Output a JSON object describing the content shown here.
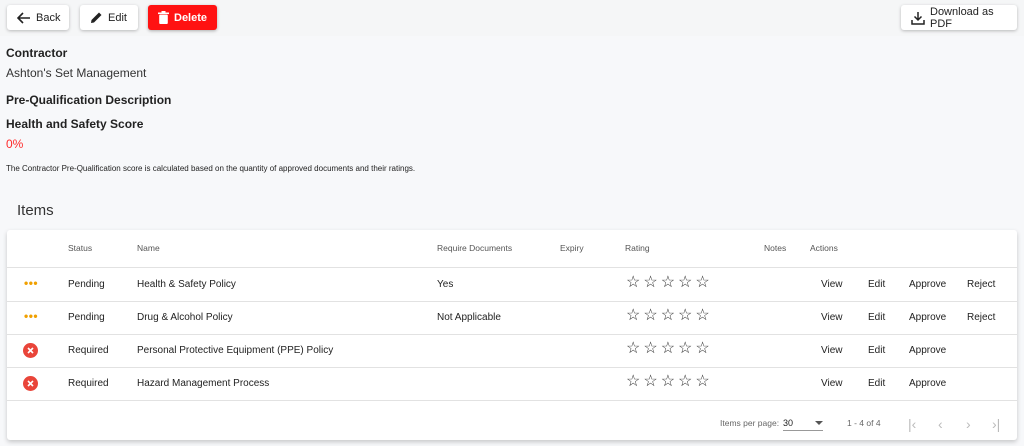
{
  "toolbar": {
    "back_label": "Back",
    "edit_label": "Edit",
    "delete_label": "Delete",
    "download_label": "Download as PDF",
    "delete_color": "#ff1212"
  },
  "details": {
    "contractor_label": "Contractor",
    "contractor_value": "Ashton's Set Management",
    "prequal_label": "Pre-Qualification Description",
    "hs_label": "Health and Safety Score",
    "hs_value": "0%",
    "score_color": "#ff2a2a",
    "note": "The Contractor Pre-Qualification score is calculated based on the quantity of approved documents and their ratings."
  },
  "items": {
    "title": "Items",
    "columns": [
      "Status",
      "Name",
      "Require Documents",
      "Expiry",
      "Rating",
      "Notes",
      "Actions"
    ],
    "rows": [
      {
        "status_icon": "pending-dots-icon",
        "status": "Pending",
        "name": "Health & Safety Policy",
        "require_documents": "Yes",
        "expiry": "",
        "rating": 0,
        "notes": "",
        "actions": [
          "View",
          "Edit",
          "Approve",
          "Reject"
        ]
      },
      {
        "status_icon": "pending-dots-icon",
        "status": "Pending",
        "name": "Drug & Alcohol Policy",
        "require_documents": "Not Applicable",
        "expiry": "",
        "rating": 0,
        "notes": "",
        "actions": [
          "View",
          "Edit",
          "Approve",
          "Reject"
        ]
      },
      {
        "status_icon": "required-x-icon",
        "status": "Required",
        "name": "Personal Protective Equipment (PPE) Policy",
        "require_documents": "",
        "expiry": "",
        "rating": 0,
        "notes": "",
        "actions": [
          "View",
          "Edit",
          "Approve"
        ]
      },
      {
        "status_icon": "required-x-icon",
        "status": "Required",
        "name": "Hazard Management Process",
        "require_documents": "",
        "expiry": "",
        "rating": 0,
        "notes": "",
        "actions": [
          "View",
          "Edit",
          "Approve"
        ]
      }
    ]
  },
  "pagination": {
    "items_per_page_label": "Items per page:",
    "items_per_page": "30",
    "range": "1 - 4 of 4"
  },
  "colors": {
    "pending": "#f0a000",
    "required": "#e9453a"
  }
}
